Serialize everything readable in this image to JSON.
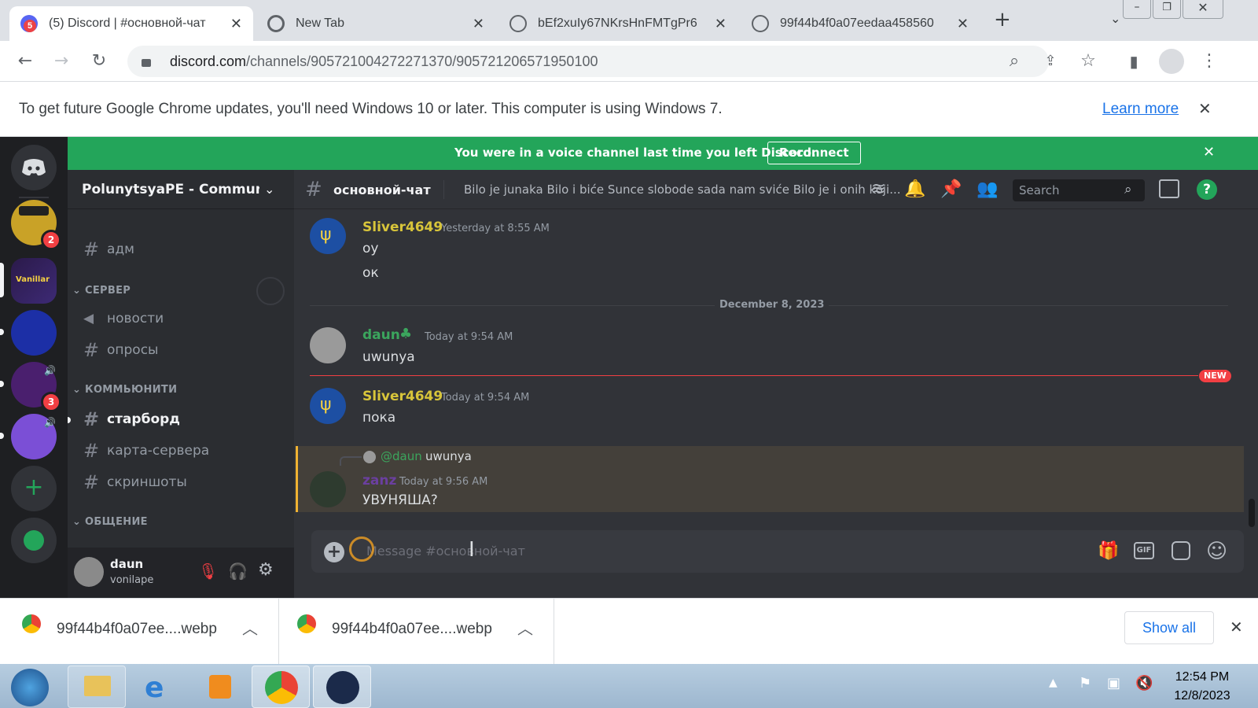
{
  "browser": {
    "tabs": [
      {
        "title": "(5) Discord | #основной-чат",
        "badge": "5"
      },
      {
        "title": "New Tab"
      },
      {
        "title": "bEf2xuIy67NKrsHnFMTgPr6"
      },
      {
        "title": "99f44b4f0a07eedaa458560"
      }
    ],
    "url_host": "discord.com",
    "url_path": "/channels/905721004272271370/905721206571950100",
    "infobar_text": "To get future Google Chrome updates, you'll need Windows 10 or later. This computer is using Windows 7.",
    "infobar_link": "Learn more"
  },
  "discord": {
    "voice_banner": "You were in a voice channel last time you left Discord.",
    "reconnect_label": "Reconnect",
    "server_badges": {
      "s1": "2",
      "s4": "3"
    },
    "server_name": "PolunytsyaPE - Community",
    "channels": {
      "adm": "адм",
      "cat_server": "СЕРВЕР",
      "news": "новости",
      "polls": "опросы",
      "cat_community": "КОММЬЮНИТИ",
      "starboard": "старборд",
      "map": "карта-сервера",
      "screens": "скриншоты",
      "cat_chat": "ОБЩЕНИЕ"
    },
    "user": {
      "name": "daun",
      "status": "vonilape"
    },
    "channel_header": {
      "name": "основной-чат",
      "topic": "Bilo je junaka Bilo i biće Sunce slobode sada nam sviće Bilo je i onih koji...",
      "search_placeholder": "Search"
    },
    "messages": [
      {
        "author": "Sliver4649",
        "time": "Yesterday at 8:55 AM",
        "lines": [
          "оу",
          "ок"
        ]
      },
      {
        "divider": "December 8, 2023"
      },
      {
        "author": "daun",
        "time": "Today at 9:54 AM",
        "lines": [
          "uwunya"
        ]
      },
      {
        "new_label": "NEW"
      },
      {
        "author": "Sliver4649",
        "time": "Today at 9:54 AM",
        "lines": [
          "пока"
        ]
      },
      {
        "reply_to": "@daun",
        "reply_text": "uwunya",
        "author": "zanz",
        "time": "Today at 9:56 AM",
        "lines": [
          "УВУНЯША?"
        ]
      }
    ],
    "composer_placeholder": "Message #основной-чат"
  },
  "downloads": {
    "items": [
      "99f44b4f0a07ee....webp",
      "99f44b4f0a07ee....webp"
    ],
    "show_all": "Show all"
  },
  "taskbar": {
    "time": "12:54 PM",
    "date": "12/8/2023"
  },
  "colors": {
    "discord_green": "#23a55a",
    "blurple": "#5865f2",
    "username_yellow": "#d8c53a",
    "username_green": "#3ba55d",
    "username_purple": "#6b3fa0"
  }
}
